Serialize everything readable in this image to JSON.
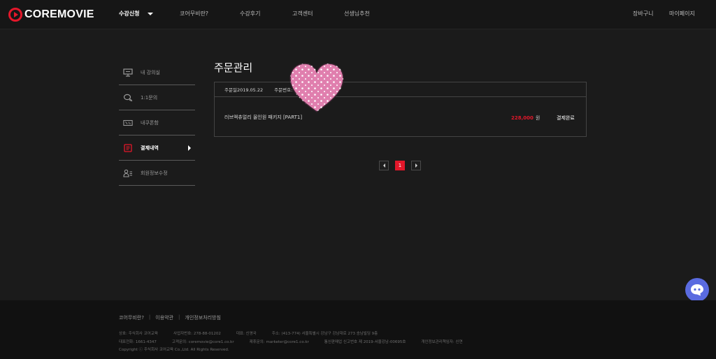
{
  "header": {
    "logo_text": "COREMOVIE",
    "nav": [
      "수강신청",
      "코어무비란?",
      "수강후기",
      "고객센터",
      "선생님추천"
    ],
    "cart": "장바구니",
    "mypage": "마이페이지"
  },
  "sidebar": {
    "items": [
      {
        "label": "내 강의실"
      },
      {
        "label": "1:1문의"
      },
      {
        "label": "내쿠폰함"
      },
      {
        "label": "결제내역"
      },
      {
        "label": "회원정보수정"
      }
    ]
  },
  "main": {
    "title": "주문관리",
    "order": {
      "date": "주문일2019.05.22",
      "number_label": "주문번호:",
      "product": "러브액츄얼리 올인원 패키지 [PART1]",
      "price": "228,000",
      "currency": "원",
      "status": "결제완료"
    },
    "pagination": {
      "current": "1"
    }
  },
  "footer": {
    "links": [
      "코어무비란?",
      "이용약관",
      "개인정보처리방침"
    ],
    "line1": [
      "상호: 주식회사 코어교육",
      "사업자번호: 278-88-01202",
      "대표: 신영국",
      "주소: (413-774) 서울특별시 강남구 강남대로 273 송남빌딩 9층"
    ],
    "line2": [
      "대표전화: 1661-4347",
      "고객문의: coremovie@core1.co.kr",
      "제휴문의: marketer@core1.co.kr",
      "통신판매업 신고번호 제 2019-서울강남-00695호",
      "개인정보관리책임자: 신연"
    ],
    "copyright": "Copyright ⓒ 주식회사 코어교육 Co.,Ltd. All Rights Reserved."
  },
  "colors": {
    "accent": "#e3172a",
    "background": "#1b1b1b",
    "chat": "#5a6be0"
  }
}
